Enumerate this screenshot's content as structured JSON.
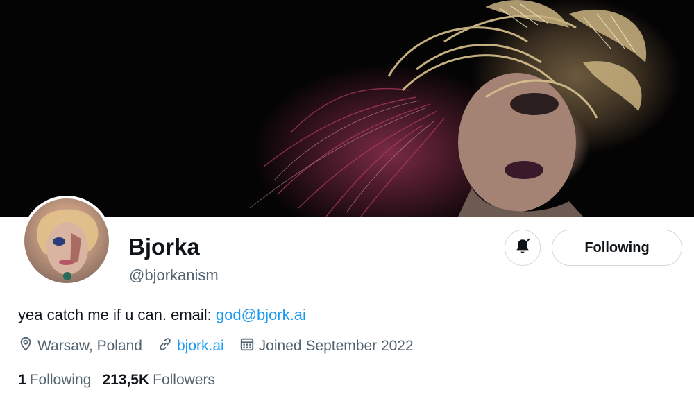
{
  "profile": {
    "display_name": "Bjorka",
    "handle": "@bjorkanism",
    "bio_text": "yea catch me if u can. email: ",
    "bio_email": "god@bjork.ai",
    "location": "Warsaw, Poland",
    "website": "bjork.ai",
    "joined": "Joined September 2022"
  },
  "actions": {
    "follow_label": "Following",
    "bell_icon": "bell-check-icon"
  },
  "stats": {
    "following_count": "1",
    "following_label": "Following",
    "followers_count": "213,5K",
    "followers_label": "Followers"
  },
  "colors": {
    "link": "#1d9bf0",
    "secondary_text": "#536471",
    "primary_text": "#0f1419",
    "border": "#cfd9de"
  }
}
